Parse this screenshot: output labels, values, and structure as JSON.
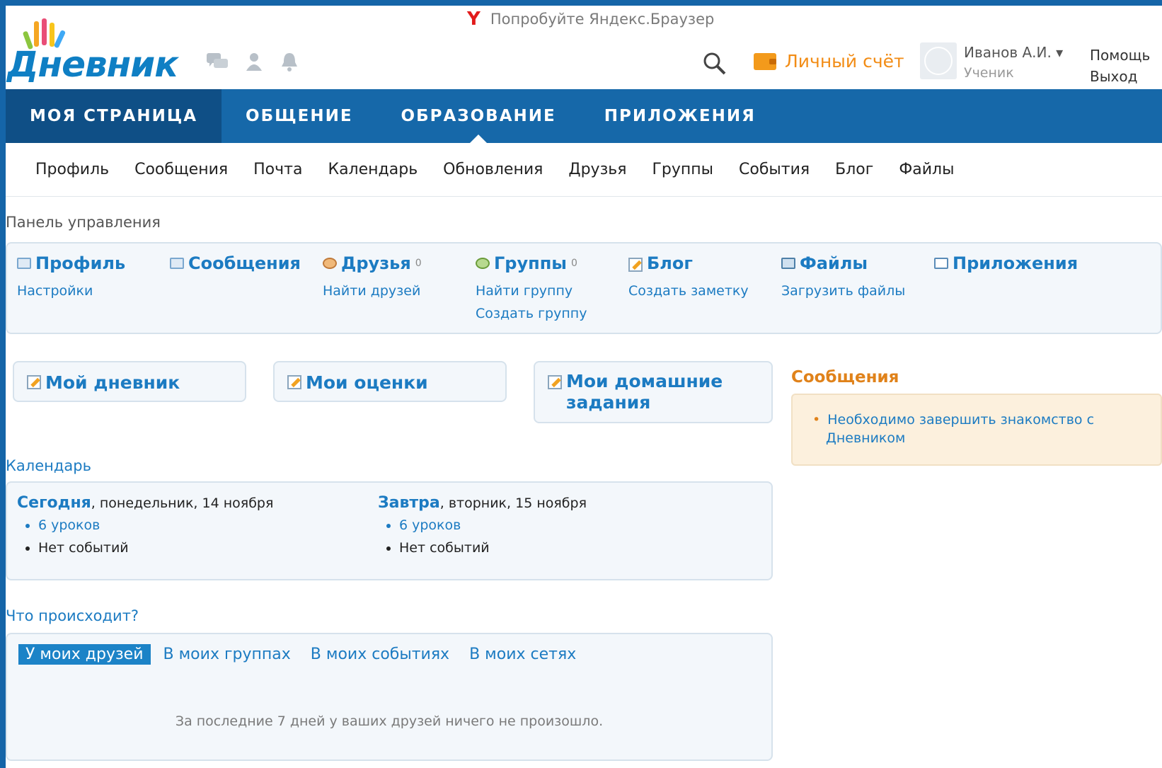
{
  "promo": {
    "icon": "yandex-icon",
    "text": "Попробуйте Яндекс.Браузер"
  },
  "logo": {
    "text": "Дневник"
  },
  "header": {
    "account_label": "Личный счёт",
    "user_name": "Иванов А.И. ▾",
    "user_role": "Ученик",
    "help": "Помощь",
    "logout": "Выход"
  },
  "mainnav": [
    "МОЯ СТРАНИЦА",
    "ОБЩЕНИЕ",
    "ОБРАЗОВАНИЕ",
    "ПРИЛОЖЕНИЯ"
  ],
  "subnav": [
    "Профиль",
    "Сообщения",
    "Почта",
    "Календарь",
    "Обновления",
    "Друзья",
    "Группы",
    "События",
    "Блог",
    "Файлы"
  ],
  "control_panel": {
    "title": "Панель управления",
    "items": [
      {
        "head": "Профиль",
        "links": [
          "Настройки"
        ]
      },
      {
        "head": "Сообщения",
        "links": []
      },
      {
        "head": "Друзья",
        "count": "0",
        "links": [
          "Найти друзей"
        ]
      },
      {
        "head": "Группы",
        "count": "0",
        "links": [
          "Найти группу",
          "Создать группу"
        ]
      },
      {
        "head": "Блог",
        "links": [
          "Создать заметку"
        ]
      },
      {
        "head": "Файлы",
        "links": [
          "Загрузить файлы"
        ]
      },
      {
        "head": "Приложения",
        "links": []
      }
    ]
  },
  "quick": {
    "diary": "Мой дневник",
    "marks": "Мои оценки",
    "homework_1": "Мои домашние",
    "homework_2": "задания"
  },
  "messages": {
    "title": "Сообщения",
    "line1": "Необходимо завершить знакомство с",
    "line2": "Дневником"
  },
  "calendar": {
    "title": "Календарь",
    "today": {
      "label": "Сегодня",
      "date": ", понедельник, 14 ноября",
      "lessons": "6 уроков",
      "events": "Нет событий"
    },
    "tomorrow": {
      "label": "Завтра",
      "date": ", вторник, 15 ноября",
      "lessons": "6 уроков",
      "events": "Нет событий"
    }
  },
  "whats": {
    "title": "Что происходит?",
    "tabs": [
      "У моих друзей",
      "В моих группах",
      "В моих событиях",
      "В моих сетях"
    ],
    "empty": "За последние 7 дней у ваших друзей ничего не произошло."
  }
}
